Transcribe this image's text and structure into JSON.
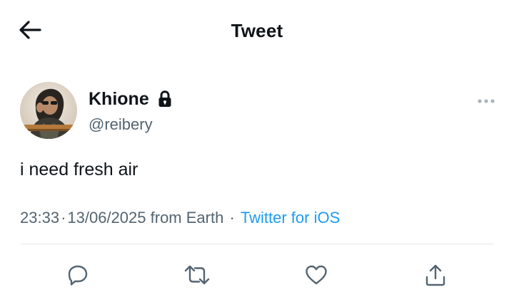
{
  "header": {
    "title": "Tweet",
    "back_icon": "arrow-left-icon"
  },
  "author": {
    "name": "Khione",
    "handle": "@reibery",
    "protected_icon": "lock-icon"
  },
  "tweet": {
    "text": "i need fresh air",
    "time": "23:33",
    "date": "13/06/2025",
    "location": "from Earth",
    "source": "Twitter for iOS"
  },
  "actions": [
    {
      "name": "reply",
      "icon": "reply-icon"
    },
    {
      "name": "retweet",
      "icon": "retweet-icon"
    },
    {
      "name": "like",
      "icon": "heart-icon"
    },
    {
      "name": "share",
      "icon": "share-icon"
    }
  ],
  "colors": {
    "text_primary": "#0f1419",
    "text_secondary": "#536471",
    "link": "#1d9bf0",
    "divider": "#e6e9eb"
  }
}
